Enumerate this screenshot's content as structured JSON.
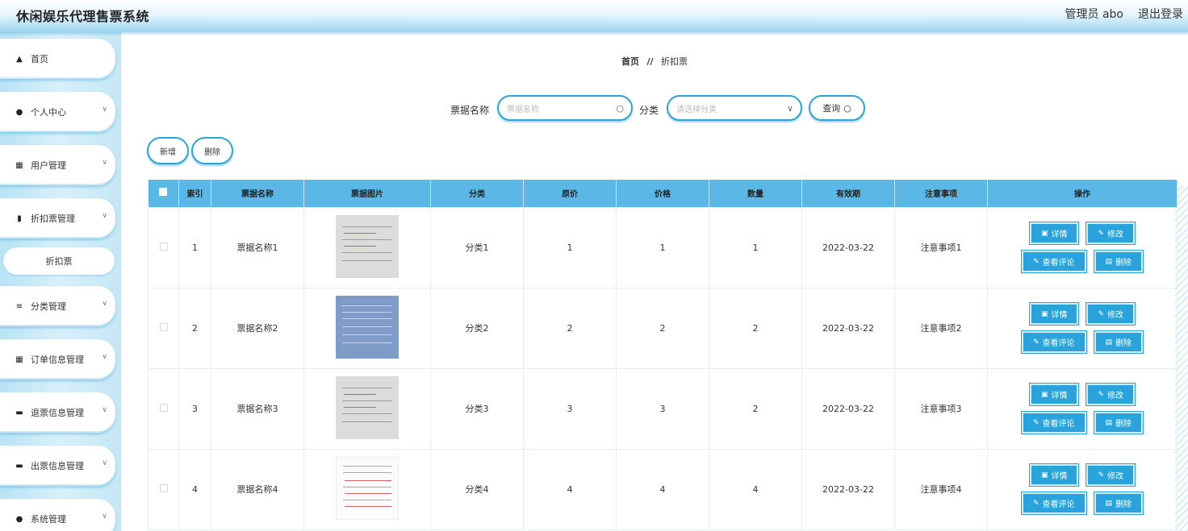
{
  "header": {
    "title": "休闲娱乐代理售票系统",
    "admin": "管理员 abo",
    "logout": "退出登录"
  },
  "sidebar": {
    "items": [
      {
        "label": "首页",
        "icon": "home-icon"
      },
      {
        "label": "个人中心",
        "icon": "user-icon"
      },
      {
        "label": "用户管理",
        "icon": "grid-icon"
      },
      {
        "label": "折扣票管理",
        "icon": "chart-icon"
      },
      {
        "label": "分类管理",
        "icon": "list-icon"
      },
      {
        "label": "订单信息管理",
        "icon": "grid-icon"
      },
      {
        "label": "退票信息管理",
        "icon": "monitor-icon"
      },
      {
        "label": "出票信息管理",
        "icon": "printer-icon"
      },
      {
        "label": "系统管理",
        "icon": "user-icon"
      }
    ],
    "active_sub": "折扣票"
  },
  "breadcrumb": {
    "home": "首页",
    "sep": "//",
    "current": "折扣票"
  },
  "search": {
    "name_label": "票据名称",
    "name_placeholder": "票据名称",
    "category_label": "分类",
    "category_placeholder": "请选择分类",
    "query_button": "查询"
  },
  "actions": {
    "add": "新增",
    "delete": "删除"
  },
  "table": {
    "columns": [
      "索引",
      "票据名称",
      "票据图片",
      "分类",
      "原价",
      "价格",
      "数量",
      "有效期",
      "注意事项",
      "操作"
    ],
    "rows": [
      {
        "index": "1",
        "name": "票据名称1",
        "category": "分类1",
        "original_price": "1",
        "price": "1",
        "quantity": "1",
        "expiry": "2022-03-22",
        "notes": "注意事项1"
      },
      {
        "index": "2",
        "name": "票据名称2",
        "category": "分类2",
        "original_price": "2",
        "price": "2",
        "quantity": "2",
        "expiry": "2022-03-22",
        "notes": "注意事项2"
      },
      {
        "index": "3",
        "name": "票据名称3",
        "category": "分类3",
        "original_price": "3",
        "price": "3",
        "quantity": "2",
        "expiry": "2022-03-22",
        "notes": "注意事项3"
      },
      {
        "index": "4",
        "name": "票据名称4",
        "category": "分类4",
        "original_price": "4",
        "price": "4",
        "quantity": "4",
        "expiry": "2022-03-22",
        "notes": "注意事项4"
      }
    ],
    "ops": {
      "detail": "详情",
      "edit": "修改",
      "comments": "查看评论",
      "delete": "删除"
    }
  },
  "colors": {
    "accent": "#2aa3dd",
    "table_header": "#5bb8e6",
    "sidebar_bg": "#c4e7f6"
  }
}
